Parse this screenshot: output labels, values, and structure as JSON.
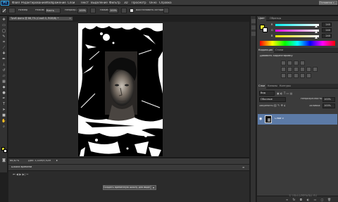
{
  "app": {
    "logo": "Ps",
    "menu": [
      "Файл",
      "Редактирование",
      "Изображение",
      "Слои",
      "Текст",
      "Выделение",
      "Фильтр",
      "3D",
      "Просмотр",
      "Окно",
      "Справка"
    ],
    "workspace": "Основная с..."
  },
  "options_bar": {
    "size_label": "Размер",
    "mode_label": "Режим:",
    "mode_value": "Кисть",
    "opacity_label": "Непрозр.:",
    "opacity_value": "100%",
    "flow_label": "Нажим:",
    "flow_value": "100%",
    "history_label": "Восстановить историю"
  },
  "document": {
    "tab_title": "Tpv6 фото @ 66,7% (Слой 0, RGB/8) *",
    "zoom": "66,67%",
    "doc_info": "Док: 3,43M/9,92M"
  },
  "timeline": {
    "title": "Шкала времени",
    "create_button": "Создать временную шкалу для видео"
  },
  "color_panel": {
    "tabs": [
      "Цвет",
      "Образцы"
    ],
    "channels": [
      {
        "label": "R",
        "value": "240",
        "level": 0.94
      },
      {
        "label": "G",
        "value": "240",
        "level": 0.94
      },
      {
        "label": "B",
        "value": "240",
        "level": 0.94
      }
    ],
    "foreground_color": "#e8e431",
    "background_color": "#ffffff"
  },
  "adjustments_panel": {
    "tabs": [
      "Коррекция",
      "Стили"
    ],
    "title": "Добавить корректировку"
  },
  "layers_panel": {
    "tabs": [
      "Слои",
      "Каналы",
      "Контуры"
    ],
    "filter_label": "Вид",
    "blend_mode": "Обычные",
    "opacity_label": "Непрозрачность:",
    "opacity_value": "100%",
    "lock_label": "Закрепить:",
    "fill_label": "Заливка:",
    "fill_value": "100%",
    "layer_name": "Слой 0"
  },
  "watermark": "© IRECOMMEND.RU",
  "colors": {
    "layer_selected": "#5c7aa6",
    "accent": "#2fa3e0"
  }
}
